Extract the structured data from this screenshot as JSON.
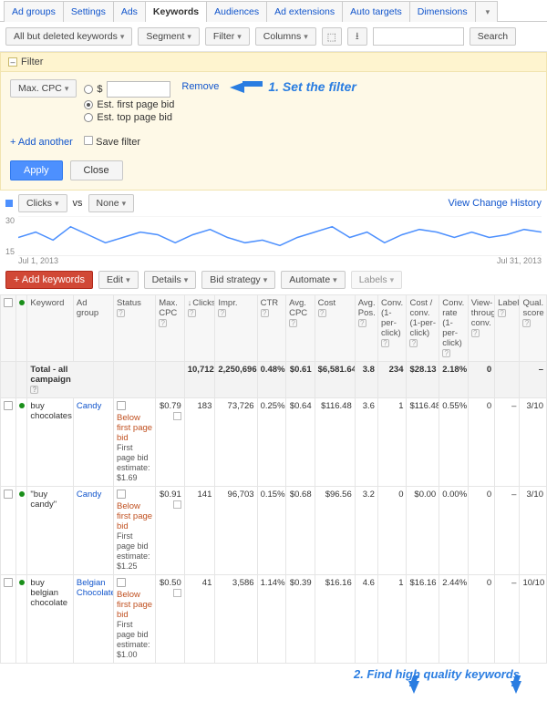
{
  "tabs": [
    "Ad groups",
    "Settings",
    "Ads",
    "Keywords",
    "Audiences",
    "Ad extensions",
    "Auto targets",
    "Dimensions"
  ],
  "active_tab_index": 3,
  "toolbar": {
    "keywords_dd": "All but deleted keywords",
    "segment": "Segment",
    "filter": "Filter",
    "columns": "Columns",
    "search_btn": "Search"
  },
  "filter": {
    "title": "Filter",
    "metric": "Max. CPC",
    "radios": [
      "$",
      "Est. first page bid",
      "Est. top page bid"
    ],
    "selected_radio": 1,
    "remove": "Remove",
    "annotation1": "1. Set the filter",
    "add_another": "+ Add another",
    "save_filter": "Save filter",
    "apply": "Apply",
    "close": "Close"
  },
  "chart": {
    "left_series": "Clicks",
    "vs": "vs",
    "right_series": "None",
    "view_history": "View Change History",
    "y_top": "30",
    "y_bot": "15",
    "x_left": "Jul 1, 2013",
    "x_right": "Jul 31, 2013"
  },
  "tbl_toolbar": {
    "add": "+ Add keywords",
    "edit": "Edit",
    "details": "Details",
    "bid": "Bid strategy",
    "automate": "Automate",
    "labels": "Labels"
  },
  "columns": [
    "",
    "",
    "Keyword",
    "Ad group",
    "Status",
    "Max. CPC",
    "Clicks",
    "Impr.",
    "CTR",
    "Avg. CPC",
    "Cost",
    "Avg. Pos.",
    "Conv. (1-per-click)",
    "Cost / conv. (1-per-click)",
    "Conv. rate (1-per-click)",
    "View-through conv.",
    "Labels",
    "Qual. score"
  ],
  "total_row": {
    "label": "Total - all campaign",
    "clicks": "10,712",
    "impr": "2,250,696",
    "ctr": "0.48%",
    "acpc": "$0.61",
    "cost": "$6,581.64",
    "pos": "3.8",
    "conv": "234",
    "cc": "$28.13",
    "cr": "2.18%",
    "vt": "0",
    "lb": "",
    "qs": "–"
  },
  "rows": [
    {
      "kw": "buy chocolates",
      "ag": "Candy",
      "status_warn": "Below first page bid",
      "status_note": "First page bid estimate: $1.69",
      "cpc": "$0.79",
      "clicks": "183",
      "impr": "73,726",
      "ctr": "0.25%",
      "acpc": "$0.64",
      "cost": "$116.48",
      "pos": "3.6",
      "conv": "1",
      "cc": "$116.48",
      "cr": "0.55%",
      "vt": "0",
      "lb": "–",
      "qs": "3/10"
    },
    {
      "kw": "\"buy candy\"",
      "ag": "Candy",
      "status_warn": "Below first page bid",
      "status_note": "First page bid estimate: $1.25",
      "cpc": "$0.91",
      "clicks": "141",
      "impr": "96,703",
      "ctr": "0.15%",
      "acpc": "$0.68",
      "cost": "$96.56",
      "pos": "3.2",
      "conv": "0",
      "cc": "$0.00",
      "cr": "0.00%",
      "vt": "0",
      "lb": "–",
      "qs": "3/10"
    },
    {
      "kw": "buy belgian chocolate",
      "ag": "Belgian Chocolate",
      "status_warn": "Below first page bid",
      "status_note": "First page bid estimate: $1.00",
      "cpc": "$0.50",
      "clicks": "41",
      "impr": "3,586",
      "ctr": "1.14%",
      "acpc": "$0.39",
      "cost": "$16.16",
      "pos": "4.6",
      "conv": "1",
      "cc": "$16.16",
      "cr": "2.44%",
      "vt": "0",
      "lb": "–",
      "qs": "10/10"
    }
  ],
  "annotation2": "2. Find high quality keywords",
  "chart_data": {
    "type": "line",
    "title": "",
    "xlabel": "",
    "ylabel": "",
    "ylim": [
      15,
      30
    ],
    "x": [
      1,
      2,
      3,
      4,
      5,
      6,
      7,
      8,
      9,
      10,
      11,
      12,
      13,
      14,
      15,
      16,
      17,
      18,
      19,
      20,
      21,
      22,
      23,
      24,
      25,
      26,
      27,
      28,
      29,
      30,
      31
    ],
    "series": [
      {
        "name": "Clicks",
        "values": [
          22,
          24,
          21,
          26,
          23,
          20,
          22,
          24,
          23,
          20,
          23,
          25,
          22,
          20,
          21,
          19,
          22,
          24,
          26,
          22,
          24,
          20,
          23,
          25,
          24,
          22,
          24,
          22,
          23,
          25,
          24
        ]
      }
    ]
  }
}
